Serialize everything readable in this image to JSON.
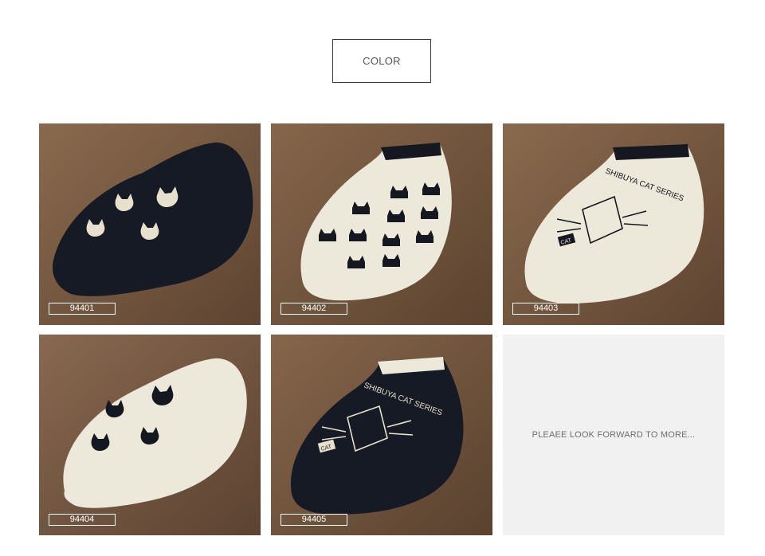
{
  "header": {
    "title": "COLOR"
  },
  "products": [
    {
      "code": "94401",
      "sock_color": "#161a24",
      "trim_color": "#161a24",
      "pattern": "cat-heads-light",
      "print_text": ""
    },
    {
      "code": "94402",
      "sock_color": "#ece8da",
      "trim_color": "#151820",
      "pattern": "peeking-cats-dark",
      "print_text": ""
    },
    {
      "code": "94403",
      "sock_color": "#ece8da",
      "trim_color": "#151820",
      "pattern": "shibuya-cat-dark",
      "print_text": "SHIBUYA CAT SERIES",
      "badge_text": "CAT"
    },
    {
      "code": "94404",
      "sock_color": "#ece8da",
      "trim_color": "#ece8da",
      "pattern": "cat-heads-dark",
      "print_text": ""
    },
    {
      "code": "94405",
      "sock_color": "#161a24",
      "trim_color": "#ece8da",
      "pattern": "shibuya-cat-light",
      "print_text": "SHIBUYA CAT SERIES",
      "badge_text": "CAT"
    }
  ],
  "placeholder": {
    "text": "PLEAEE LOOK FORWARD TO MORE..."
  }
}
